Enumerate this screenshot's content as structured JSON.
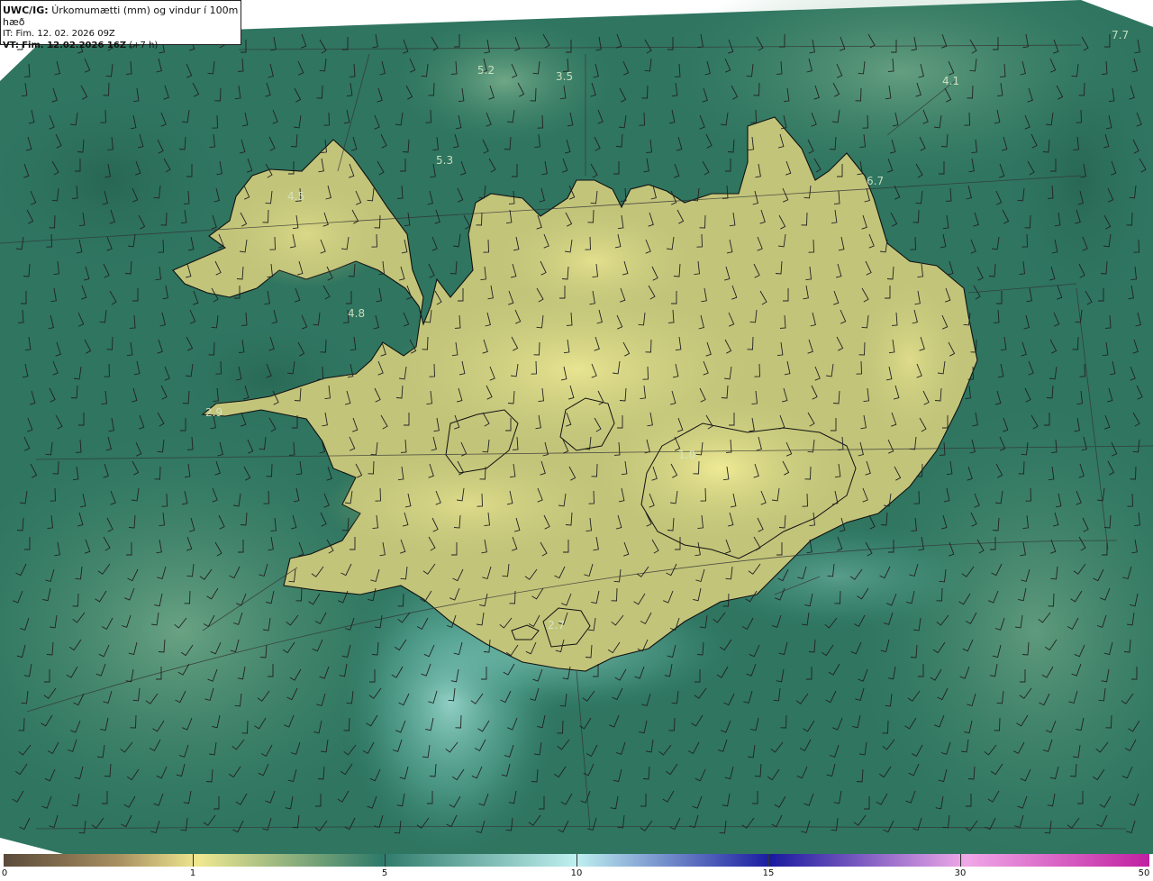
{
  "header": {
    "product": "UWC/IG:",
    "title": "Úrkomumætti (mm) og vindur í 100m hæð",
    "it_label": "IT:",
    "it_value": "Fim. 12. 02. 2026 09Z",
    "vt_label": "VT:",
    "vt_value": "Fim. 12.02.2026 16Z",
    "vt_offset": "(+7 h)"
  },
  "map_labels": [
    {
      "text": "5.2"
    },
    {
      "text": "3.5"
    },
    {
      "text": "4.1"
    },
    {
      "text": "7.7"
    },
    {
      "text": "5.3"
    },
    {
      "text": "4.5"
    },
    {
      "text": "6.7"
    },
    {
      "text": "4.8"
    },
    {
      "text": "2.9"
    },
    {
      "text": "1.0"
    },
    {
      "text": "2.7"
    }
  ],
  "colorbar": {
    "ticks": [
      "0",
      "1",
      "5",
      "10",
      "15",
      "30",
      "50"
    ],
    "colors": [
      "#5a4a3a",
      "#a89060",
      "#f0e890",
      "#2e7a6a",
      "#bff0f0",
      "#1a1aa0",
      "#f0a8e8",
      "#c020a0"
    ]
  },
  "colors": {
    "sea_base": "#2f7560",
    "land_base": "#c9c97a",
    "highland": "#ece890",
    "coastline": "#111111"
  }
}
